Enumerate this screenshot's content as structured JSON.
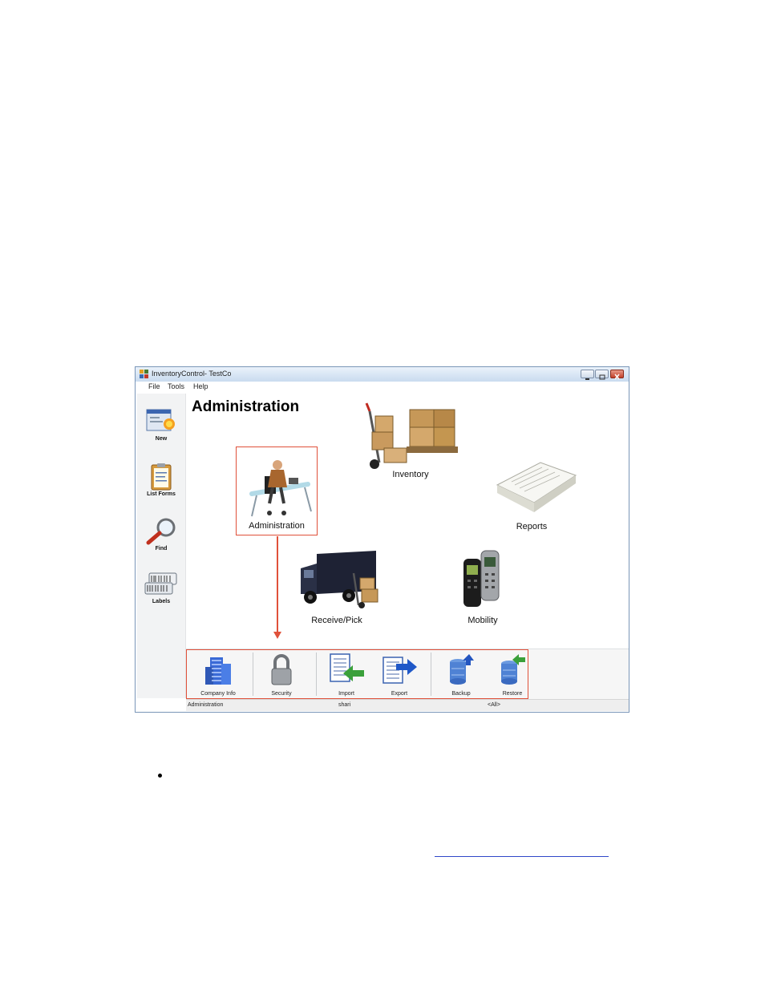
{
  "window": {
    "title": "InventoryControl- TestCo"
  },
  "menu": [
    "File",
    "Tools",
    "Help"
  ],
  "sidebar": {
    "items": [
      {
        "label": "New",
        "icon": "new-form-icon"
      },
      {
        "label": "List Forms",
        "icon": "clipboard-icon"
      },
      {
        "label": "Find",
        "icon": "magnifier-icon"
      },
      {
        "label": "Labels",
        "icon": "labels-icon"
      }
    ]
  },
  "main": {
    "title": "Administration",
    "modules": {
      "inventory": "Inventory",
      "administration": "Administration",
      "reports": "Reports",
      "receive_pick": "Receive/Pick",
      "mobility": "Mobility"
    }
  },
  "toolbar": {
    "items": [
      {
        "label": "Company Info",
        "icon": "building-icon"
      },
      {
        "label": "Security",
        "icon": "padlock-icon"
      },
      {
        "label": "Import",
        "icon": "import-icon"
      },
      {
        "label": "Export",
        "icon": "export-icon"
      },
      {
        "label": "Backup",
        "icon": "backup-icon"
      },
      {
        "label": "Restore",
        "icon": "restore-icon"
      }
    ]
  },
  "status": {
    "section": "Administration",
    "user": "shari",
    "filter": "<All>"
  },
  "colors": {
    "highlight": "#e0513a",
    "link": "#3047c9"
  }
}
